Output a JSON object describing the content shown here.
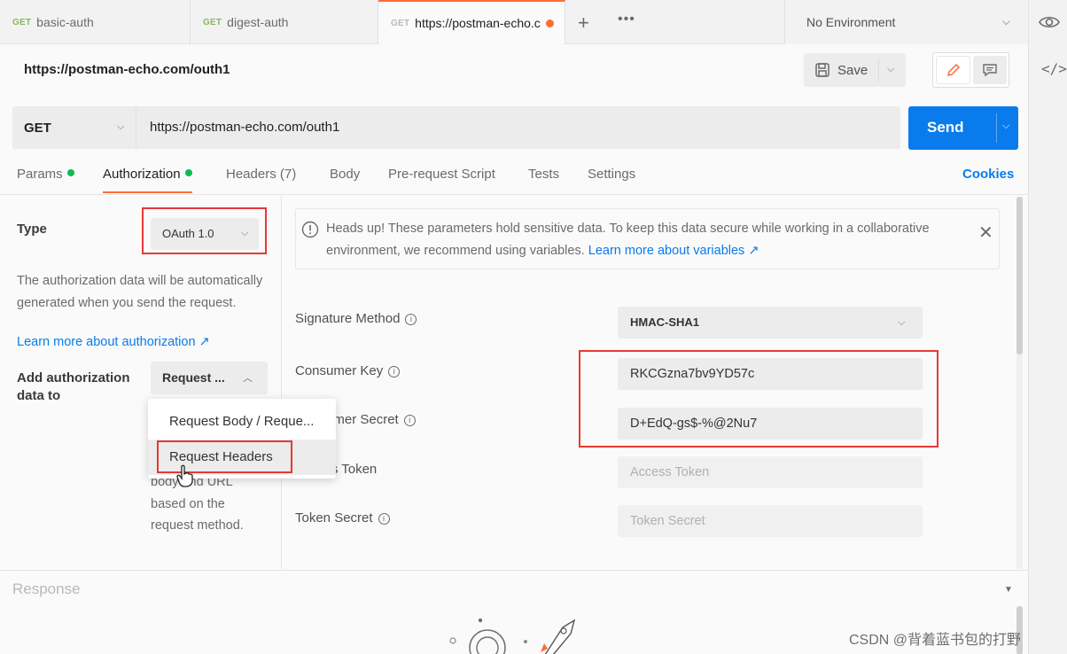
{
  "tabs": [
    {
      "method": "GET",
      "name": "basic-auth"
    },
    {
      "method": "GET",
      "name": "digest-auth"
    },
    {
      "method": "GET",
      "name": "https://postman-echo.c"
    }
  ],
  "environment": "No Environment",
  "request": {
    "title": "https://postman-echo.com/outh1",
    "save_label": "Save",
    "method": "GET",
    "url": "https://postman-echo.com/outh1",
    "send_label": "Send"
  },
  "subtabs": {
    "params": "Params",
    "authorization": "Authorization",
    "headers": "Headers",
    "headers_count": "(7)",
    "body": "Body",
    "prerequest": "Pre-request Script",
    "tests": "Tests",
    "settings": "Settings",
    "cookies": "Cookies"
  },
  "auth": {
    "type_label": "Type",
    "type_value": "OAuth 1.0",
    "desc": "The authorization data will be automatically generated when you send the request.",
    "learn_more": "Learn more about authorization ↗",
    "add_label": "Add authorization data to",
    "add_value": "Request ...",
    "behind_lines": [
      "body and URL",
      "based on the",
      "request method."
    ],
    "menu": [
      "Request Body / Reque...",
      "Request Headers"
    ]
  },
  "alert": {
    "text": "Heads up! These parameters hold sensitive data. To keep this data secure while working in a collaborative environment, we recommend using variables.",
    "link": "Learn more about variables ↗"
  },
  "fields": {
    "signature_method": {
      "label": "Signature Method",
      "value": "HMAC-SHA1"
    },
    "consumer_key": {
      "label": "Consumer Key",
      "value": "RKCGzna7bv9YD57c"
    },
    "consumer_secret": {
      "label": "Consumer Secret",
      "value": "D+EdQ-gs$-%@2Nu7"
    },
    "access_token": {
      "label": "Access Token",
      "placeholder": "Access Token"
    },
    "token_secret": {
      "label": "Token Secret",
      "placeholder": "Token Secret"
    }
  },
  "response": {
    "title": "Response"
  },
  "watermark": "CSDN @背着蓝书包的打野",
  "colors": {
    "accent": "#ff6c37",
    "primary": "#097bed",
    "highlight": "#e53935",
    "dot": "#0cbb52"
  }
}
